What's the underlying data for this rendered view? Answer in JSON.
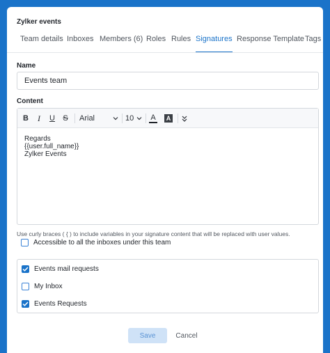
{
  "page": {
    "title": "Zylker events"
  },
  "tabs": [
    {
      "label": "Team details"
    },
    {
      "label": "Inboxes"
    },
    {
      "label": "Members (6)"
    },
    {
      "label": "Roles"
    },
    {
      "label": "Rules"
    },
    {
      "label": "Signatures"
    },
    {
      "label": "Response Template"
    },
    {
      "label": "Tags"
    }
  ],
  "active_tab": "Signatures",
  "form": {
    "name_label": "Name",
    "name_value": "Events team",
    "content_label": "Content"
  },
  "editor": {
    "toolbar": {
      "font": "Arial",
      "size": "10",
      "text_color_glyph": "A",
      "highlight_glyph": "A"
    },
    "lines": [
      "Regards",
      "{{user.full_name}}",
      "Zylker Events"
    ]
  },
  "hint": "Use curly braces ( { ) to include variables in your signature content that will be replaced with user values.",
  "accessible_all": {
    "label": "Accessible to all the inboxes under this team",
    "checked": false
  },
  "inboxes": [
    {
      "label": "Events mail requests",
      "checked": true
    },
    {
      "label": "My Inbox",
      "checked": false
    },
    {
      "label": "Events Requests",
      "checked": true
    }
  ],
  "actions": {
    "save": "Save",
    "cancel": "Cancel"
  },
  "colors": {
    "accent": "#1a73c9",
    "background": "#1a73c9"
  }
}
